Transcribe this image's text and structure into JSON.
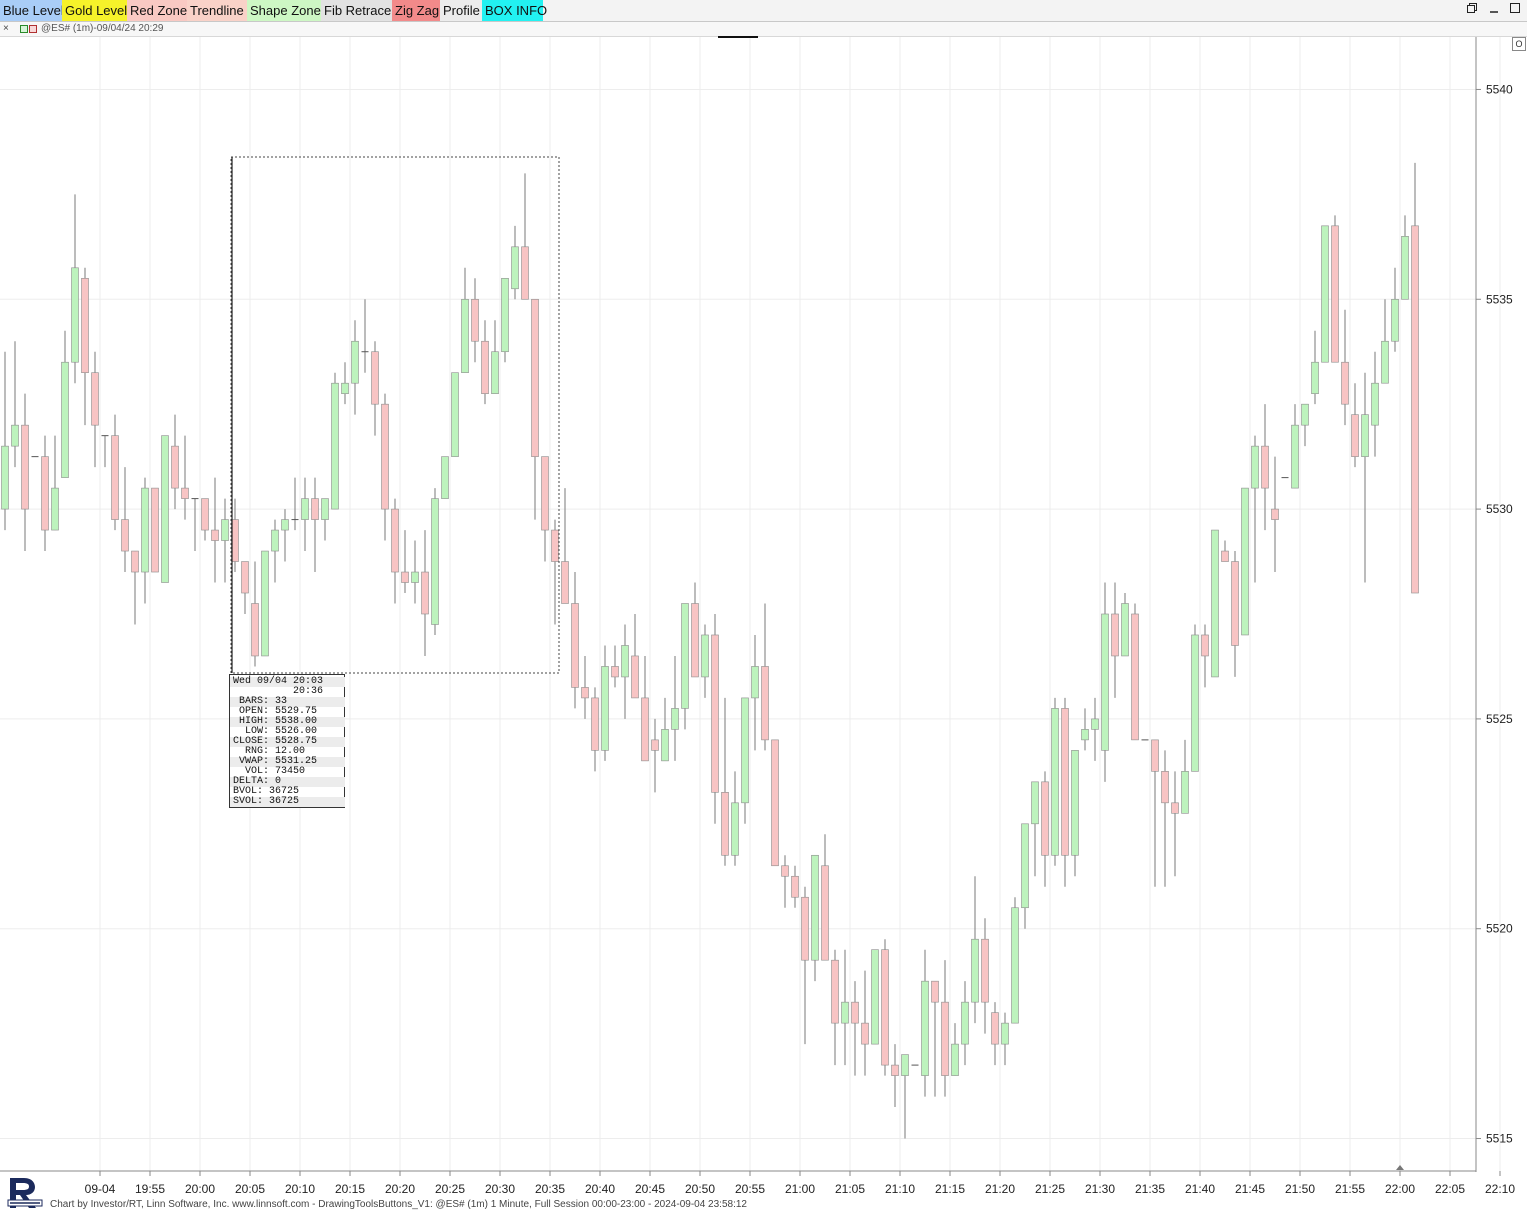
{
  "toolbar": {
    "buttons": [
      {
        "label": "Blue Level",
        "color": "#a9cdf7"
      },
      {
        "label": "Gold Level",
        "color": "#f6f22a"
      },
      {
        "label": "Red Zone",
        "color": "#f9c9c3"
      },
      {
        "label": "Trendline",
        "color": "#f9d2c8"
      },
      {
        "label": "Shape Zone",
        "color": "#cdf7c4"
      },
      {
        "label": "Fib Retrace",
        "color": "#e2e2e2"
      },
      {
        "label": "Zig Zag",
        "color": "#f28a8a"
      },
      {
        "label": "Profile",
        "color": "#ececec"
      },
      {
        "label": "BOX INFO",
        "color": "#22f2f2"
      }
    ],
    "restore_icon": "restore-window-icon",
    "minimize_icon": "minimize-icon",
    "maximize_icon": "maximize-icon"
  },
  "chart_title": {
    "close_symbol": "×",
    "text": "@ES# (1m)-09/04/24 20:29"
  },
  "right_tiny_button": "O",
  "footer": {
    "text": "Chart by Investor/RT, Linn Software, Inc. www.linnsoft.com - DrawingToolsButtons_V1: @ES# (1m) 1 Minute, Full Session 00:00-23:00 - 2024-09-04 23:58:12"
  },
  "box_info": {
    "rows": [
      "Wed 09/04 20:03",
      "          20:36",
      " BARS: 33",
      " OPEN: 5529.75",
      " HIGH: 5538.00",
      "  LOW: 5526.00",
      "CLOSE: 5528.75",
      "  RNG: 12.00",
      " VWAP: 5531.25",
      "  VOL: 73450",
      "DELTA: 0",
      "BVOL: 36725",
      "SVOL: 36725"
    ]
  },
  "colors": {
    "up_candle": "#bdf3bd",
    "down_candle": "#f8c4c4",
    "wick": "#7a7a7a",
    "grid": "#ededed",
    "axis": "#888888"
  },
  "chart_data": {
    "type": "candlestick",
    "symbol": "@ES#",
    "interval": "1m",
    "date": "09/04/24",
    "y_ticks": [
      5515,
      5520,
      5525,
      5530,
      5535,
      5540
    ],
    "y_range": [
      5514.25,
      5541.25
    ],
    "x_ticks": [
      "09-04",
      "19:55",
      "20:00",
      "20:05",
      "20:10",
      "20:15",
      "20:20",
      "20:25",
      "20:30",
      "20:35",
      "20:40",
      "20:45",
      "20:50",
      "20:55",
      "21:00",
      "21:05",
      "21:10",
      "21:15",
      "21:20",
      "21:25",
      "21:30",
      "21:35",
      "21:40",
      "21:45",
      "21:50",
      "21:55",
      "22:00",
      "22:05",
      "22:10"
    ],
    "first_bar_time": "19:46",
    "columns": [
      "open",
      "high",
      "low",
      "close"
    ],
    "candles": [
      [
        5530.0,
        5533.75,
        5529.5,
        5531.5
      ],
      [
        5531.5,
        5534.0,
        5531.0,
        5532.0
      ],
      [
        5532.0,
        5532.75,
        5529.0,
        5530.0
      ],
      [
        5531.25,
        5531.25,
        5531.25,
        5531.25
      ],
      [
        5531.25,
        5531.75,
        5529.0,
        5529.5
      ],
      [
        5529.5,
        5531.75,
        5529.5,
        5530.5
      ],
      [
        5530.75,
        5534.25,
        5530.75,
        5533.5
      ],
      [
        5533.5,
        5537.5,
        5533.0,
        5535.75
      ],
      [
        5535.5,
        5535.75,
        5532.0,
        5533.25
      ],
      [
        5533.25,
        5533.75,
        5531.0,
        5532.0
      ],
      [
        5531.75,
        5531.75,
        5531.0,
        5531.75
      ],
      [
        5531.75,
        5532.25,
        5529.5,
        5529.75
      ],
      [
        5529.75,
        5531.0,
        5528.5,
        5529.0
      ],
      [
        5529.0,
        5529.0,
        5527.25,
        5528.5
      ],
      [
        5528.5,
        5530.75,
        5527.75,
        5530.5
      ],
      [
        5530.5,
        5530.5,
        5528.5,
        5528.5
      ],
      [
        5528.25,
        5531.75,
        5528.25,
        5531.75
      ],
      [
        5531.5,
        5532.25,
        5530.0,
        5530.5
      ],
      [
        5530.5,
        5531.75,
        5529.75,
        5530.25
      ],
      [
        5530.25,
        5530.25,
        5529.0,
        5530.25
      ],
      [
        5530.25,
        5530.25,
        5529.25,
        5529.5
      ],
      [
        5529.5,
        5530.75,
        5528.25,
        5529.25
      ],
      [
        5529.25,
        5530.25,
        5528.25,
        5529.75
      ],
      [
        5529.75,
        5530.25,
        5528.5,
        5528.75
      ],
      [
        5528.75,
        5528.75,
        5527.5,
        5528.0
      ],
      [
        5527.75,
        5528.75,
        5526.25,
        5526.5
      ],
      [
        5526.5,
        5528.75,
        5526.5,
        5529.0
      ],
      [
        5529.0,
        5529.75,
        5528.25,
        5529.5
      ],
      [
        5529.5,
        5530.0,
        5528.75,
        5529.75
      ],
      [
        5529.75,
        5530.75,
        5529.5,
        5529.75
      ],
      [
        5529.75,
        5530.75,
        5529.0,
        5530.25
      ],
      [
        5530.25,
        5530.75,
        5528.5,
        5529.75
      ],
      [
        5529.75,
        5530.25,
        5529.25,
        5530.25
      ],
      [
        5530.0,
        5533.25,
        5530.0,
        5533.0
      ],
      [
        5532.75,
        5533.5,
        5532.5,
        5533.0
      ],
      [
        5533.0,
        5534.5,
        5532.25,
        5534.0
      ],
      [
        5533.75,
        5535.0,
        5533.25,
        5533.75
      ],
      [
        5533.75,
        5534.0,
        5531.75,
        5532.5
      ],
      [
        5532.5,
        5532.75,
        5529.25,
        5530.0
      ],
      [
        5530.0,
        5530.25,
        5527.75,
        5528.5
      ],
      [
        5528.5,
        5529.5,
        5528.0,
        5528.25
      ],
      [
        5528.25,
        5529.25,
        5527.75,
        5528.5
      ],
      [
        5528.5,
        5529.5,
        5526.5,
        5527.5
      ],
      [
        5527.25,
        5530.5,
        5527.0,
        5530.25
      ],
      [
        5530.25,
        5531.25,
        5530.25,
        5531.25
      ],
      [
        5531.25,
        5533.25,
        5531.25,
        5533.25
      ],
      [
        5533.25,
        5535.75,
        5533.25,
        5535.0
      ],
      [
        5535.0,
        5535.5,
        5533.5,
        5534.0
      ],
      [
        5534.0,
        5534.5,
        5532.5,
        5532.75
      ],
      [
        5532.75,
        5534.5,
        5532.75,
        5533.75
      ],
      [
        5533.75,
        5535.25,
        5533.5,
        5535.5
      ],
      [
        5535.25,
        5536.75,
        5535.0,
        5536.25
      ],
      [
        5536.25,
        5538.0,
        5535.25,
        5535.0
      ],
      [
        5535.0,
        5535.0,
        5529.75,
        5531.25
      ],
      [
        5531.25,
        5531.25,
        5528.75,
        5529.5
      ],
      [
        5529.5,
        5529.75,
        5527.25,
        5528.75
      ],
      [
        5528.75,
        5530.5,
        5527.75,
        5527.75
      ],
      [
        5527.75,
        5528.5,
        5525.25,
        5525.75
      ],
      [
        5525.75,
        5526.5,
        5525.0,
        5525.5
      ],
      [
        5525.5,
        5525.75,
        5523.75,
        5524.25
      ],
      [
        5524.25,
        5526.75,
        5524.0,
        5526.25
      ],
      [
        5526.25,
        5526.75,
        5525.75,
        5526.0
      ],
      [
        5526.0,
        5527.25,
        5525.0,
        5526.75
      ],
      [
        5526.5,
        5527.5,
        5525.5,
        5525.5
      ],
      [
        5525.5,
        5526.5,
        5524.25,
        5524.0
      ],
      [
        5524.5,
        5525.0,
        5523.25,
        5524.25
      ],
      [
        5524.0,
        5525.5,
        5524.0,
        5524.75
      ],
      [
        5524.75,
        5526.5,
        5524.0,
        5525.25
      ],
      [
        5525.25,
        5527.75,
        5524.75,
        5527.75
      ],
      [
        5527.75,
        5528.25,
        5526.75,
        5526.0
      ],
      [
        5526.0,
        5527.25,
        5525.5,
        5527.0
      ],
      [
        5527.0,
        5527.5,
        5522.5,
        5523.25
      ],
      [
        5523.25,
        5525.5,
        5521.5,
        5521.75
      ],
      [
        5521.75,
        5523.75,
        5521.5,
        5523.0
      ],
      [
        5523.0,
        5525.5,
        5522.5,
        5525.5
      ],
      [
        5525.5,
        5527.0,
        5524.25,
        5526.25
      ],
      [
        5526.25,
        5527.75,
        5524.25,
        5524.5
      ],
      [
        5524.5,
        5524.5,
        5521.5,
        5521.5
      ],
      [
        5521.5,
        5521.75,
        5520.5,
        5521.25
      ],
      [
        5521.25,
        5521.5,
        5520.5,
        5520.75
      ],
      [
        5520.75,
        5521.0,
        5517.25,
        5519.25
      ],
      [
        5519.25,
        5521.75,
        5518.75,
        5521.75
      ],
      [
        5521.5,
        5522.25,
        5519.5,
        5519.25
      ],
      [
        5519.25,
        5519.5,
        5516.75,
        5517.75
      ],
      [
        5517.75,
        5519.5,
        5516.75,
        5518.25
      ],
      [
        5518.25,
        5518.75,
        5516.5,
        5517.75
      ],
      [
        5517.75,
        5519.0,
        5516.5,
        5517.25
      ],
      [
        5517.25,
        5519.5,
        5517.25,
        5519.5
      ],
      [
        5519.5,
        5519.75,
        5516.5,
        5516.75
      ],
      [
        5516.75,
        5517.25,
        5515.75,
        5516.5
      ],
      [
        5516.5,
        5517.0,
        5515.0,
        5517.0
      ],
      [
        5516.75,
        5516.75,
        5516.75,
        5516.75
      ],
      [
        5516.5,
        5519.5,
        5516.0,
        5518.75
      ],
      [
        5518.75,
        5518.75,
        5516.0,
        5518.25
      ],
      [
        5518.25,
        5519.25,
        5516.0,
        5516.5
      ],
      [
        5516.5,
        5517.75,
        5516.5,
        5517.25
      ],
      [
        5517.25,
        5518.75,
        5516.75,
        5518.25
      ],
      [
        5518.25,
        5521.25,
        5517.75,
        5519.75
      ],
      [
        5519.75,
        5520.25,
        5517.5,
        5518.25
      ],
      [
        5518.0,
        5518.25,
        5516.75,
        5517.25
      ],
      [
        5517.25,
        5518.0,
        5516.75,
        5517.75
      ],
      [
        5517.75,
        5520.75,
        5517.75,
        5520.5
      ],
      [
        5520.5,
        5522.5,
        5520.0,
        5522.5
      ],
      [
        5522.5,
        5523.25,
        5521.25,
        5523.5
      ],
      [
        5523.5,
        5523.75,
        5521.0,
        5521.75
      ],
      [
        5521.75,
        5525.5,
        5521.5,
        5525.25
      ],
      [
        5525.25,
        5525.5,
        5521.0,
        5521.75
      ],
      [
        5521.75,
        5524.25,
        5521.25,
        5524.25
      ],
      [
        5524.5,
        5525.25,
        5524.25,
        5524.75
      ],
      [
        5524.75,
        5525.5,
        5524.0,
        5525.0
      ],
      [
        5524.25,
        5528.25,
        5523.5,
        5527.5
      ],
      [
        5527.5,
        5528.25,
        5525.5,
        5526.5
      ],
      [
        5526.5,
        5528.0,
        5526.5,
        5527.75
      ],
      [
        5527.5,
        5527.75,
        5524.5,
        5524.5
      ],
      [
        5524.5,
        5524.5,
        5524.5,
        5524.5
      ],
      [
        5524.5,
        5524.5,
        5521.0,
        5523.75
      ],
      [
        5523.75,
        5524.25,
        5521.0,
        5523.0
      ],
      [
        5523.0,
        5523.75,
        5521.25,
        5522.75
      ],
      [
        5522.75,
        5524.5,
        5522.75,
        5523.75
      ],
      [
        5523.75,
        5527.25,
        5523.75,
        5527.0
      ],
      [
        5527.0,
        5527.25,
        5525.75,
        5526.5
      ],
      [
        5526.0,
        5529.5,
        5526.0,
        5529.5
      ],
      [
        5529.0,
        5529.25,
        5528.75,
        5528.75
      ],
      [
        5528.75,
        5529.0,
        5526.0,
        5526.75
      ],
      [
        5527.0,
        5530.5,
        5527.0,
        5530.5
      ],
      [
        5530.5,
        5531.75,
        5528.25,
        5531.5
      ],
      [
        5531.5,
        5532.5,
        5529.5,
        5530.5
      ],
      [
        5530.0,
        5531.25,
        5528.5,
        5529.75
      ],
      [
        5530.75,
        5530.75,
        5530.75,
        5530.75
      ],
      [
        5530.5,
        5532.5,
        5530.5,
        5532.0
      ],
      [
        5532.0,
        5532.5,
        5531.5,
        5532.5
      ],
      [
        5532.75,
        5534.25,
        5532.5,
        5533.5
      ],
      [
        5533.5,
        5536.75,
        5533.5,
        5536.75
      ],
      [
        5536.75,
        5537.0,
        5533.5,
        5533.5
      ],
      [
        5533.5,
        5534.75,
        5532.0,
        5532.5
      ],
      [
        5532.25,
        5533.0,
        5531.0,
        5531.25
      ],
      [
        5531.25,
        5533.25,
        5528.25,
        5532.25
      ],
      [
        5532.0,
        5533.75,
        5531.25,
        5533.0
      ],
      [
        5533.0,
        5535.0,
        5533.0,
        5534.0
      ],
      [
        5534.0,
        5535.75,
        5533.75,
        5535.0
      ],
      [
        5535.0,
        5537.0,
        5535.0,
        5536.5
      ],
      [
        5536.75,
        5538.25,
        5528.0,
        5528.0
      ]
    ]
  }
}
